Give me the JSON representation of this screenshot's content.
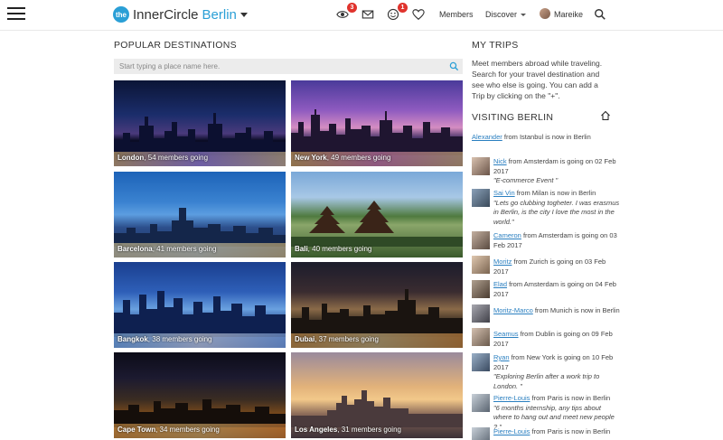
{
  "header": {
    "logo_badge": "the",
    "logo_main": "InnerCircle",
    "logo_city": "Berlin",
    "notifications": {
      "views": "3",
      "smiley": "1"
    },
    "nav": {
      "members": "Members",
      "discover": "Discover",
      "user": "Mareike"
    },
    "icons": [
      "menu-icon",
      "eye-icon",
      "mail-icon",
      "smiley-icon",
      "heart-icon",
      "search-icon"
    ]
  },
  "popular": {
    "title": "POPULAR DESTINATIONS",
    "search_placeholder": "Start typing a place name here.",
    "destinations": [
      {
        "city": "London",
        "going": ", 54 members going"
      },
      {
        "city": "New York",
        "going": ", 49 members going"
      },
      {
        "city": "Barcelona",
        "going": ", 41 members going"
      },
      {
        "city": "Bali",
        "going": ", 40 members going"
      },
      {
        "city": "Bangkok",
        "going": ", 38 members going"
      },
      {
        "city": "Dubai",
        "going": ", 37 members going"
      },
      {
        "city": "Cape Town",
        "going": ", 34 members going"
      },
      {
        "city": "Los Angeles",
        "going": ", 31 members going"
      }
    ]
  },
  "trips": {
    "title": "MY TRIPS",
    "text": "Meet members abroad while traveling. Search for your travel destination and see who else is going. You can add a Trip by clicking on the \"+\"."
  },
  "visiting": {
    "title": "VISITING BERLIN",
    "entries": [
      {
        "name": "Alexander",
        "text": " from Istanbul is now in Berlin",
        "quote": ""
      },
      {
        "name": "Nick",
        "text": " from Amsterdam is going on 02 Feb 2017",
        "quote": "\"E-commerce Event \""
      },
      {
        "name": "Sai Vin",
        "text": " from Milan is now in Berlin",
        "quote": "\"Lets go clubbing togheter. I was erasmus in Berlin, is the city I love the most in the world.\""
      },
      {
        "name": "Cameron",
        "text": " from Amsterdam is going on 03 Feb 2017",
        "quote": ""
      },
      {
        "name": "Moritz",
        "text": " from Zurich is going on 03 Feb 2017",
        "quote": ""
      },
      {
        "name": "Elad",
        "text": " from Amsterdam is going on 04 Feb 2017",
        "quote": ""
      },
      {
        "name": "Moritz-Marco",
        "text": " from Munich is now in Berlin",
        "quote": ""
      },
      {
        "name": "Seamus",
        "text": " from Dublin is going on 09 Feb 2017",
        "quote": ""
      },
      {
        "name": "Ryan",
        "text": " from New York is going on 10 Feb 2017",
        "quote": "\"Exploring Berlin after a work trip to London. \""
      },
      {
        "name": "Pierre-Louis",
        "text": " from Paris is now in Berlin",
        "quote": "\"6 months internship, any tips about where to hang out and meet new people ? \""
      },
      {
        "name": "Pierre-Louis",
        "text": " from Paris is now in Berlin",
        "quote": ""
      }
    ]
  }
}
